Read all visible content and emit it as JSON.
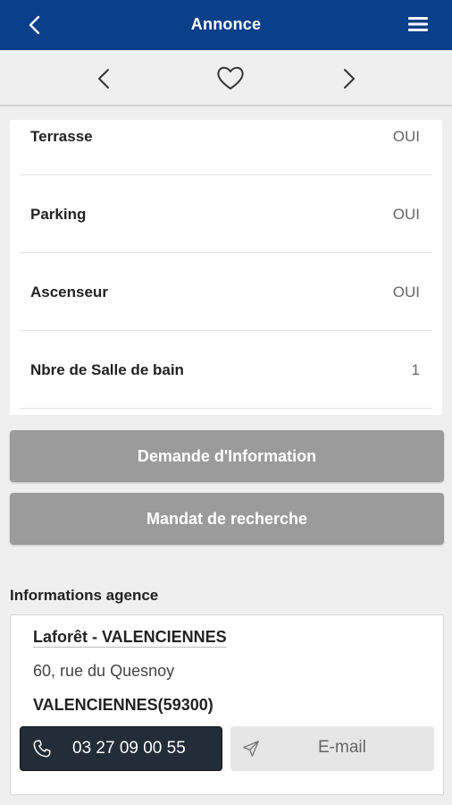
{
  "header": {
    "title": "Annonce",
    "bg_color": "#0a3f8a"
  },
  "nav": {
    "prev_icon": "chevron-left-icon",
    "favorite_icon": "heart-outline-icon",
    "next_icon": "chevron-right-icon"
  },
  "features": [
    {
      "label": "Terrasse",
      "value": "OUI"
    },
    {
      "label": "Parking",
      "value": "OUI"
    },
    {
      "label": "Ascenseur",
      "value": "OUI"
    },
    {
      "label": "Nbre de Salle de bain",
      "value": "1"
    }
  ],
  "actions": {
    "info_request_label": "Demande d'Information",
    "search_mandate_label": "Mandat de recherche"
  },
  "agency": {
    "heading": "Informations agence",
    "name": "Laforêt - VALENCIENNES",
    "street": "60, rue du Quesnoy",
    "city": "VALENCIENNES(59300)",
    "phone": "03 27 09 00 55",
    "email_label": "E-mail"
  }
}
